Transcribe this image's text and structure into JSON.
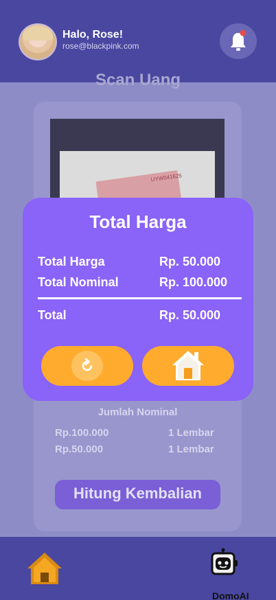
{
  "header": {
    "greeting": "Halo, Rose!",
    "email": "rose@blackpink.com",
    "notification_icon": "bell-icon",
    "notification_dot_color": "#e84b4b"
  },
  "background": {
    "title": "Scan Uang",
    "jumlah_title": "Jumlah Nominal",
    "rows": [
      {
        "value": "Rp.100.000",
        "qty": "1 Lembar"
      },
      {
        "value": "Rp.50.000",
        "qty": "1 Lembar"
      }
    ],
    "hitung_label": "Hitung Kembalian"
  },
  "modal": {
    "title": "Total Harga",
    "rows": [
      {
        "label": "Total Harga",
        "value": "Rp. 50.000"
      },
      {
        "label": "Total Nominal",
        "value": "Rp. 100.000"
      }
    ],
    "total": {
      "label": "Total",
      "value": "Rp. 50.000"
    },
    "reload_icon": "reload-icon",
    "home_icon": "home-icon"
  },
  "bottom_nav": {
    "home_icon": "home-icon",
    "domo_label": "DomoAI"
  },
  "colors": {
    "header": "#4a47a0",
    "modal": "#8a63f8",
    "accent": "#ffab2e"
  }
}
